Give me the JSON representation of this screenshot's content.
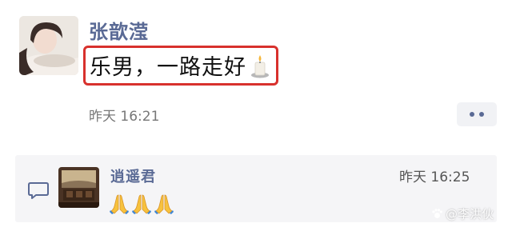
{
  "post": {
    "author": "张歆滢",
    "text": "乐男，一路走好",
    "emoji": "candle-icon",
    "time": "昨天 16:21"
  },
  "comment": {
    "author": "逍遥君",
    "time": "昨天 16:25",
    "emojis": [
      "folded-hands-icon",
      "folded-hands-icon",
      "folded-hands-icon"
    ]
  },
  "watermark": {
    "text": "@李洪伙"
  },
  "colors": {
    "name_blue": "#5a6a95",
    "highlight_red": "#d8312d",
    "comment_bg": "#f5f5f7"
  }
}
